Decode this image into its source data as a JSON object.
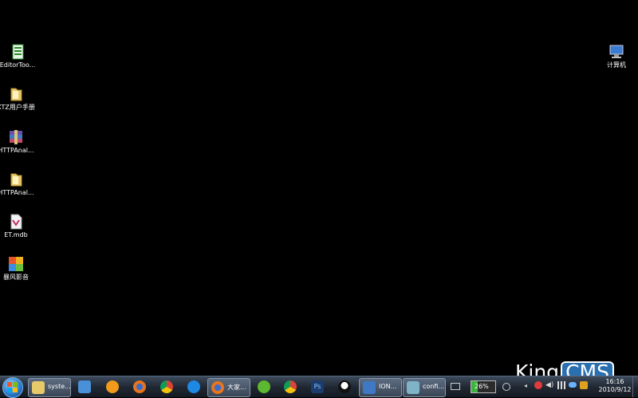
{
  "desktop": {
    "icons_left": [
      {
        "label": "EditorToo...",
        "icon": "editor-tool-icon"
      },
      {
        "label": "XTZ用户手册",
        "icon": "folder-icon"
      },
      {
        "label": "HTTPAnal...",
        "icon": "winrar-archive-icon"
      },
      {
        "label": "HTTPAnal...",
        "icon": "folder-icon"
      },
      {
        "label": "ET.mdb",
        "icon": "database-file-icon"
      },
      {
        "label": "暴风影音",
        "icon": "media-player-icon"
      }
    ],
    "icon_right": {
      "label": "计算机",
      "icon": "computer-icon"
    }
  },
  "taskbar": {
    "start": {
      "icon": "windows-start-icon"
    },
    "buttons": [
      {
        "label": "syste...",
        "icon": "folder-icon"
      },
      {
        "label": "",
        "icon": "remote-desktop-icon"
      },
      {
        "label": "",
        "icon": "browser-orange-icon"
      },
      {
        "label": "",
        "icon": "firefox-icon"
      },
      {
        "label": "",
        "icon": "chrome-icon"
      },
      {
        "label": "",
        "icon": "ie-icon"
      },
      {
        "label": "大家...",
        "icon": "firefox-icon"
      },
      {
        "label": "",
        "icon": "green-app-icon"
      },
      {
        "label": "",
        "icon": "chrome-icon"
      },
      {
        "label": "",
        "icon": "photoshop-icon"
      },
      {
        "label": "",
        "icon": "qq-icon"
      },
      {
        "label": "ION...",
        "icon": "network-window-icon"
      },
      {
        "label": "confi...",
        "icon": "config-window-icon"
      }
    ],
    "ps_label": "Ps"
  },
  "tray": {
    "battery_percent": "26%",
    "battery_level": 0.26,
    "time": "16:16",
    "date": "2010/9/12"
  },
  "watermark": {
    "king": "King",
    "cms": "CMS"
  }
}
